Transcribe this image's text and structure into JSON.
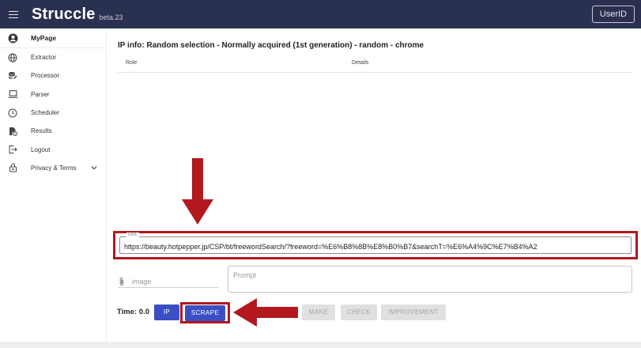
{
  "header": {
    "brand": "Struccle",
    "version": "beta.23",
    "user_button": "UserID"
  },
  "sidebar": {
    "items": [
      {
        "label": "MyPage",
        "icon": "account-circle-icon"
      },
      {
        "label": "Extractor",
        "icon": "globe-icon"
      },
      {
        "label": "Processor",
        "icon": "database-edit-icon"
      },
      {
        "label": "Parser",
        "icon": "laptop-icon"
      },
      {
        "label": "Scheduler",
        "icon": "clock-icon"
      },
      {
        "label": "Results",
        "icon": "file-clock-icon"
      },
      {
        "label": "Logout",
        "icon": "logout-icon"
      },
      {
        "label": "Privacy & Terms",
        "icon": "lock-icon"
      }
    ]
  },
  "main": {
    "ip_title": "IP info: Random selection - Normally acquired (1st generation) - random - chrome",
    "table": {
      "columns": [
        "Role",
        "Details"
      ]
    },
    "url_field": {
      "label": "URL",
      "value": "https://beauty.hotpepper.jp/CSP/bt/freewordSearch/?freeword=%E6%B8%8B%E8%B0%B7&searchT=%E6%A4%9C%E7%B4%A2"
    },
    "image_field": {
      "label": "image"
    },
    "prompt": {
      "placeholder": "Prompt"
    },
    "time": "Time: 0.0",
    "buttons": {
      "ip": "IP",
      "scrape": "SCRAPE",
      "make": "MAKE",
      "check": "CHECK",
      "improvement": "IMPROVEMENT"
    }
  },
  "colors": {
    "topbar": "#2a3050",
    "primary_button": "#3a4fc4",
    "annotation_red": "#b3181f",
    "disabled_button": "#e0e0e0"
  }
}
